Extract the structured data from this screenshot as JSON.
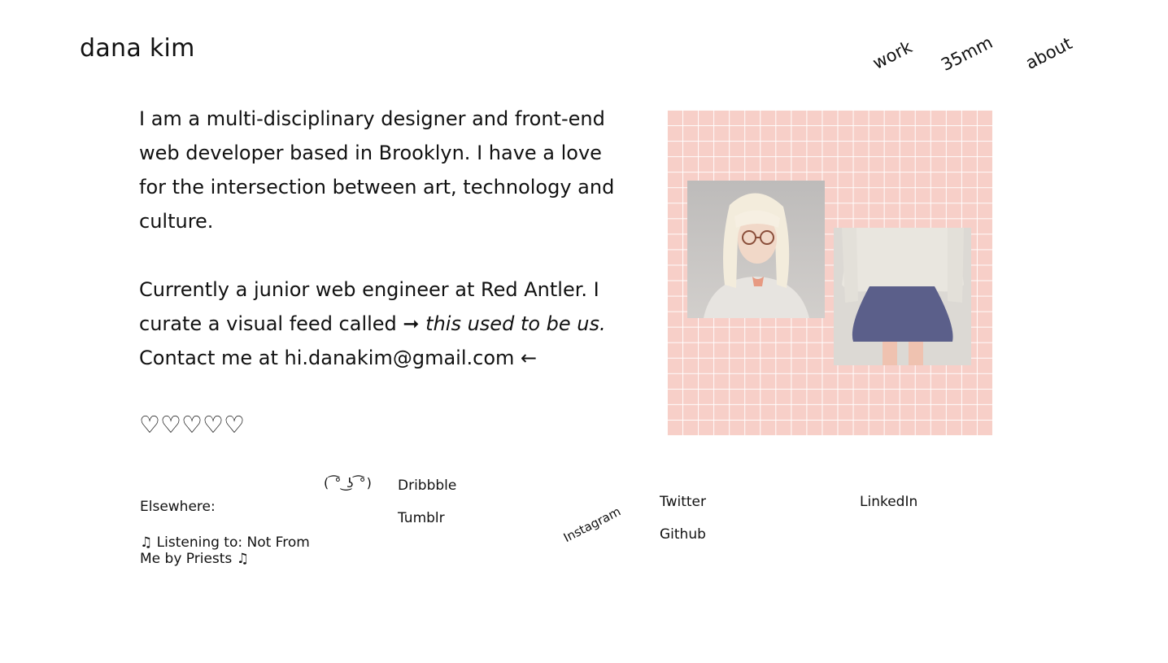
{
  "header": {
    "brand": "dana kim",
    "nav": [
      "work",
      "35mm",
      "about"
    ]
  },
  "bio": {
    "p1": "I am a multi-disciplinary designer and front-end web developer based in Brooklyn. I have a love for the intersection between art, technology and culture.",
    "p2_prefix": "Currently a junior web engineer at Red Antler. I curate a visual feed called ➞ ",
    "p2_feed": "this used to be us.",
    "p2_suffix": " Contact me at hi.danakim@gmail.com ←",
    "hearts": "♡♡♡♡♡"
  },
  "images": {
    "panel_color": "#f7cfc8",
    "photo1": "portrait-photo",
    "photo2": "sweater-skirt-photo"
  },
  "footer": {
    "elsewhere_label": "Elsewhere:",
    "listening": "♫ Listening to: Not From Me by Priests ♫",
    "lenny": "( ͡° ͜ʖ ͡°)",
    "links": {
      "dribbble": "Dribbble",
      "tumblr": "Tumblr",
      "instagram": "Instagram",
      "twitter": "Twitter",
      "github": "Github",
      "linkedin": "LinkedIn"
    }
  }
}
